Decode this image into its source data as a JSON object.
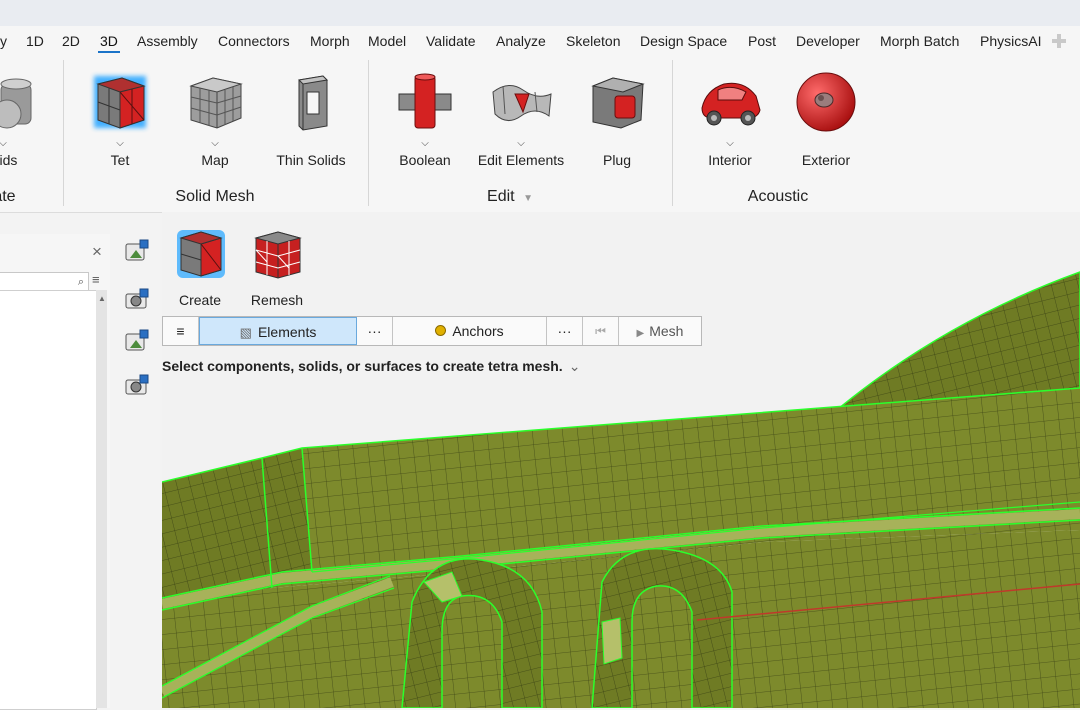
{
  "menu": {
    "tabs": [
      "y",
      "1D",
      "2D",
      "3D",
      "Assembly",
      "Connectors",
      "Morph",
      "Model",
      "Validate",
      "Analyze",
      "Skeleton",
      "Design Space",
      "Post",
      "Developer",
      "Morph Batch",
      "PhysicsAI"
    ],
    "active_tab": "3D"
  },
  "ribbon": {
    "tools": [
      "olids",
      "Tet",
      "Map",
      "Thin Solids",
      "Boolean",
      "Edit Elements",
      "Plug",
      "Interior",
      "Exterior"
    ],
    "groups": [
      "eate",
      "Solid Mesh",
      "Edit",
      "Acoustic"
    ],
    "group_arrow": "▼"
  },
  "panel": {
    "close": "×"
  },
  "context": {
    "tools": [
      "Create",
      "Remesh"
    ],
    "guide": {
      "menu": "≡",
      "elements": "Elements",
      "more1": "···",
      "anchors": "Anchors",
      "more2": "···",
      "first": "⏮",
      "mesh": "Mesh",
      "play": "▶"
    },
    "prompt": "Select components, solids, or surfaces to create tetra mesh."
  },
  "colors": {
    "accent": "#1a73c8",
    "mesh_fill": "#7d8a2c",
    "mesh_edge": "#2bff2b",
    "tool_red": "#d42222"
  },
  "icons": [
    "search-icon",
    "filter-icon",
    "close-icon",
    "chevron-down-icon",
    "plus-icon",
    "elements-icon",
    "anchor-icon",
    "first-icon",
    "play-icon",
    "expand-icon"
  ]
}
